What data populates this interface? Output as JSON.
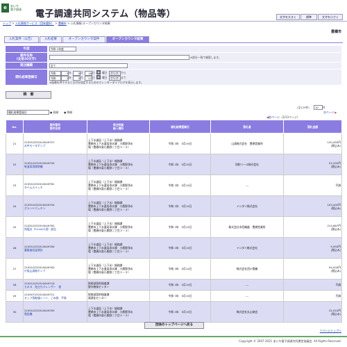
{
  "header": {
    "logo_mark": "e",
    "logo_line1": "あいち",
    "logo_line2": "電子調達",
    "title": "電子調達共同システム（物品等）",
    "btn_large": "文字を大きく",
    "btn_std": "標準",
    "btn_small": "文字を小さく"
  },
  "breadcrumb": {
    "top": "トップ",
    "sep1": " > ",
    "svc": "入札情報サービス（団体選択）",
    "sep2": " > ",
    "org": "豊橋市",
    "sep3": " > ",
    "current": "入札情報:オープンカウンタ結果"
  },
  "org_name": "豊橋市",
  "tabs": [
    "入札案件（公告）",
    "入札結果",
    "オープンカウンタ案件",
    "オープンカウンタ結果"
  ],
  "form": {
    "year_label": "年度",
    "year_value": "令和 3年度",
    "name_label": "案件名称\n(全角30文字)",
    "name_note": "※部分一致で検索します。",
    "type_label": "発注機関",
    "type_value": "全て",
    "date_label": "開札結果登録日",
    "from_era": "令和",
    "from_y": "3",
    "from_m": "5",
    "from_d": "16",
    "to_era": "令和",
    "to_y": "3",
    "to_m": "5",
    "to_d": "22",
    "y_unit": "年",
    "m_unit": "月",
    "d_unit": "日",
    "cal": "曜日",
    "clear": "クリア",
    "from_suffix": "から",
    "to_suffix": "まで",
    "date_note": "※画像を押下すると日付を指定するためのカレンダーダイアログを表示します。",
    "search_btn": "検　索"
  },
  "controls": {
    "sort_value": "開札結果登録日",
    "asc": "昇順",
    "desc": "降順",
    "count_text": "(全129件)",
    "per_page": "10",
    "per_unit": "件",
    "next": "次ページ",
    "prev": "前ページ",
    "page_info": "（3/13ページ）"
  },
  "table": {
    "headers": {
      "no": "No.",
      "case": "案件番号\n案件名称",
      "org": "発注所属\n納入場所",
      "date": "開札結果登録日",
      "winner": "落札者",
      "amount": "落札金額"
    },
    "rows": [
      {
        "no": "21",
        "id": "210510232010049757",
        "name": "水中モータポンプ",
        "org": "上下水道局（上下水）総務課",
        "place1": "豊橋市上下水道局浄水課　小鷹野浄水",
        "place2": "場（豊橋市東小鷹野二丁目３－３）",
        "date": "令和 3年　5月19日",
        "winner": "山清株式会社　豊橋営業所",
        "amount": "120,450円",
        "amount2": "(税込み)"
      },
      {
        "no": "22",
        "id": "210510232010049755",
        "name": "乾湿両用掃除機",
        "org": "上下水道局（上下水）総務課",
        "place1": "豊橋市上下水道局浄水課　小鷹野浄水",
        "place2": "場（豊橋市東小鷹野二丁目３－３）",
        "date": "令和 3年　5月19日",
        "winner": "同和リース株式会社",
        "amount": "52,250円",
        "amount2": "(税込み)"
      },
      {
        "no": "23",
        "id": "210510232010049761",
        "name": "タイムスイッチ",
        "org": "上下水道局（上下水）総務課",
        "place1": "豊橋市上下水道局浄水課　小鷹野浄水",
        "place2": "場（豊橋市東小鷹野二丁目３－３）",
        "date": "令和 3年　5月19日",
        "winner": "---",
        "amount": "不調",
        "amount2": ""
      },
      {
        "no": "24",
        "id": "210510232010049754",
        "name": "グランドパッキン",
        "org": "上下水道局（上下水）総務課",
        "place1": "豊橋市上下水道局浄水課　小鷹野浄水",
        "place2": "場（豊橋市東小鷹野二丁目３－３）",
        "date": "令和 3年　5月19日",
        "winner": "イシダイ株式会社",
        "amount": "103,400円",
        "amount2": "(税込み)"
      },
      {
        "no": "25",
        "id": "210510232010049762",
        "name": "残塩計（FG400G用）部品",
        "org": "上下水道局（上下水）総務課",
        "place1": "豊橋市上下水道局浄水課　小鷹野浄水",
        "place2": "場（豊橋市東小鷹野二丁目３－３）",
        "date": "令和 3年　5月19日",
        "winner": "株式会社市西機器　豊橋営業所",
        "amount": "214,667円",
        "amount2": "(税込み)"
      },
      {
        "no": "26",
        "id": "210510232010049764",
        "name": "蓄乗量低温測計",
        "org": "上下水道局（上下水）総務課",
        "place1": "豊橋市上下水道局浄水課　小鷹野浄水",
        "place2": "場（豊橋市東小鷹野二丁目３－３）",
        "date": "令和 3年　5月19日",
        "winner": "イシダイ株式会社",
        "amount": "5,950円",
        "amount2": "(税込み)"
      },
      {
        "no": "27",
        "id": "210510232010049763",
        "name": "片吸込渦巻ポンプ",
        "org": "上下水道局（上下水）総務課",
        "place1": "豊橋市上下水道局浄水課　小鷹野浄水",
        "place2": "場（豊橋市東小鷹野二丁目３－３）",
        "date": "令和 3年　5月19日",
        "winner": "株式会社西川電機",
        "amount": "94,000円",
        "amount2": "(税込み)"
      },
      {
        "no": "28",
        "id": "210510232010049716",
        "name": "カネヨ　泡立ちクレンザー　他",
        "org": "財務部契約検査課",
        "place1": "野外教育センター",
        "place2": "",
        "date": "令和 3年　5月19日",
        "winner": "---",
        "amount": "不調",
        "amount2": ""
      },
      {
        "no": "29",
        "id": "210507232010049721",
        "name": "セップ用乾燥シート、ごみ袋、手袋",
        "org": "財務部契約検査課",
        "place1": "資源化センター",
        "place2": "",
        "date": "令和 3年　5月19日",
        "winner": "---",
        "amount": "不調",
        "amount2": ""
      },
      {
        "no": "30",
        "id": "210510232010049763",
        "name": "電話機",
        "org": "上下水道局（上下水）総務課",
        "place1": "豊橋市上下水道局浄水課　小鷹野浄水",
        "place2": "場（豊橋市東小鷹野二丁目３－３）",
        "date": "令和 3年　5月19日",
        "winner": "株式会社丸山商会",
        "amount": "32,010円",
        "amount2": "(税込み)"
      }
    ]
  },
  "back_button": "団体のトップページへ戻る",
  "page_top": "↑ページトップへ",
  "copyright": "Copyright © 2007-2021 あいち電子調達共同運営協議会. All Rights Reserved.",
  "colors": {
    "accent": "#8a7ce0",
    "row_alt": "#dcdcf4",
    "logo": "#2a6a3a"
  }
}
